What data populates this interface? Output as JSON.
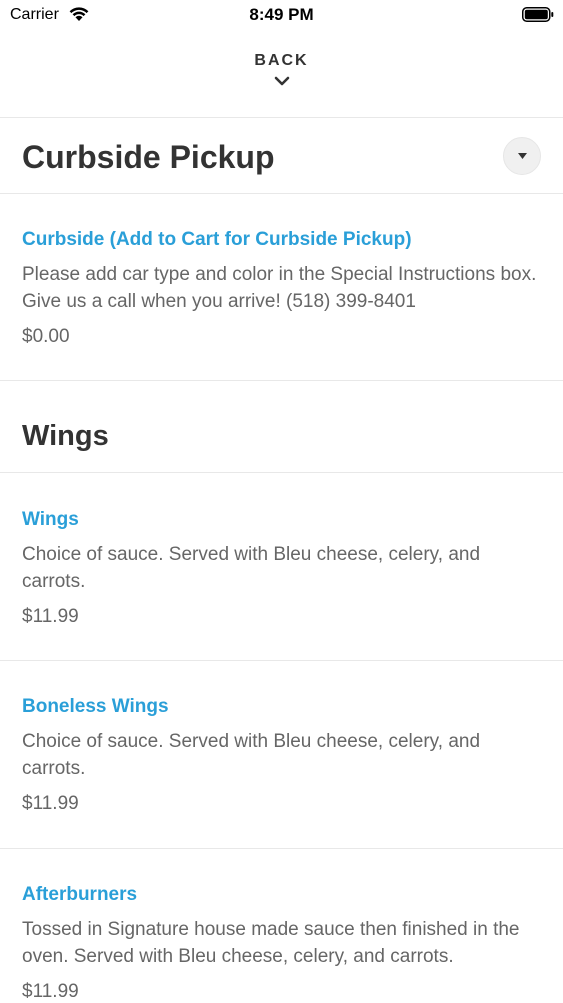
{
  "status": {
    "carrier": "Carrier",
    "time": "8:49 PM"
  },
  "nav": {
    "back_label": "BACK"
  },
  "sections": [
    {
      "title": "Curbside Pickup",
      "items": [
        {
          "name": "Curbside (Add to Cart for Curbside Pickup)",
          "description": "Please add car type and color in the Special Instructions box. Give us a call when you arrive! (518) 399-8401",
          "price": "$0.00"
        }
      ]
    },
    {
      "title": "Wings",
      "items": [
        {
          "name": "Wings",
          "description": "Choice of sauce. Served with Bleu cheese, celery, and carrots.",
          "price": "$11.99"
        },
        {
          "name": "Boneless Wings",
          "description": "Choice of sauce. Served with Bleu cheese, celery, and carrots.",
          "price": "$11.99"
        },
        {
          "name": "Afterburners",
          "description": "Tossed in Signature house made sauce then finished in the oven. Served with Bleu cheese, celery, and carrots.",
          "price": "$11.99"
        }
      ]
    }
  ],
  "colors": {
    "accent": "#2a9fd8",
    "text": "#333333",
    "secondary_text": "#666666",
    "divider": "#e8e8e8"
  }
}
